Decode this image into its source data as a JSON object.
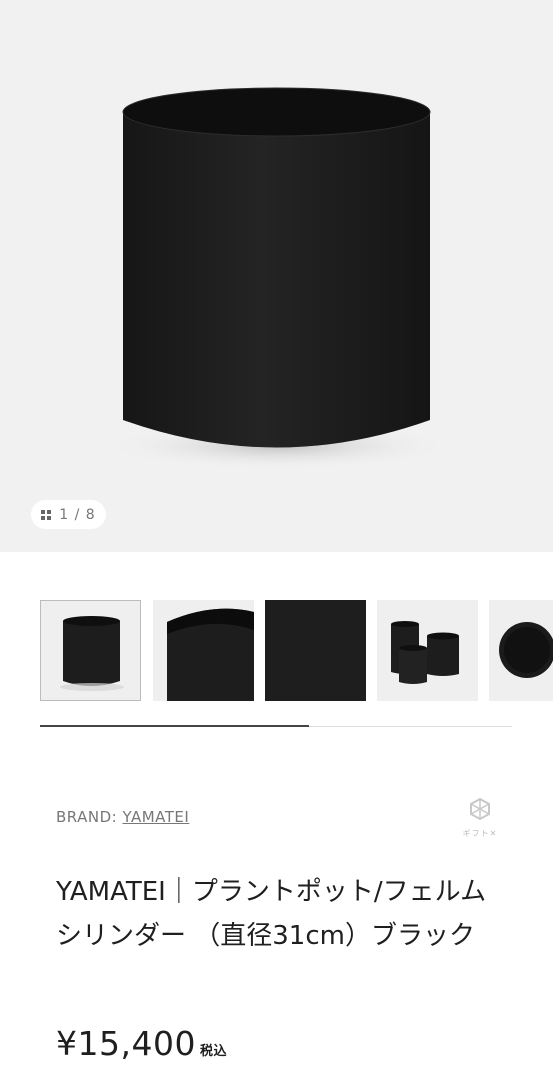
{
  "gallery": {
    "counter": "1 / 8",
    "main_image_icon": "black-cylinder-pot",
    "thumbnails": [
      {
        "icon": "pot-full-view"
      },
      {
        "icon": "pot-closeup-rim"
      },
      {
        "icon": "felt-texture"
      },
      {
        "icon": "three-pots-group"
      },
      {
        "icon": "pot-top-view"
      }
    ],
    "scroll_progress": 0.57
  },
  "product": {
    "brand_label": "BRAND: ",
    "brand_name": "YAMATEI",
    "gift_label": "ギフト✕",
    "title": "YAMATEI｜プラントポット/フェルム シリンダー （直径31cm）ブラック",
    "price": "¥15,400",
    "tax_label": "税込"
  },
  "colors": {
    "hero_bg": "#f1f1f1",
    "product_black": "#1c1c1c",
    "text_dark": "#1f1f1f",
    "text_muted": "#777777"
  }
}
